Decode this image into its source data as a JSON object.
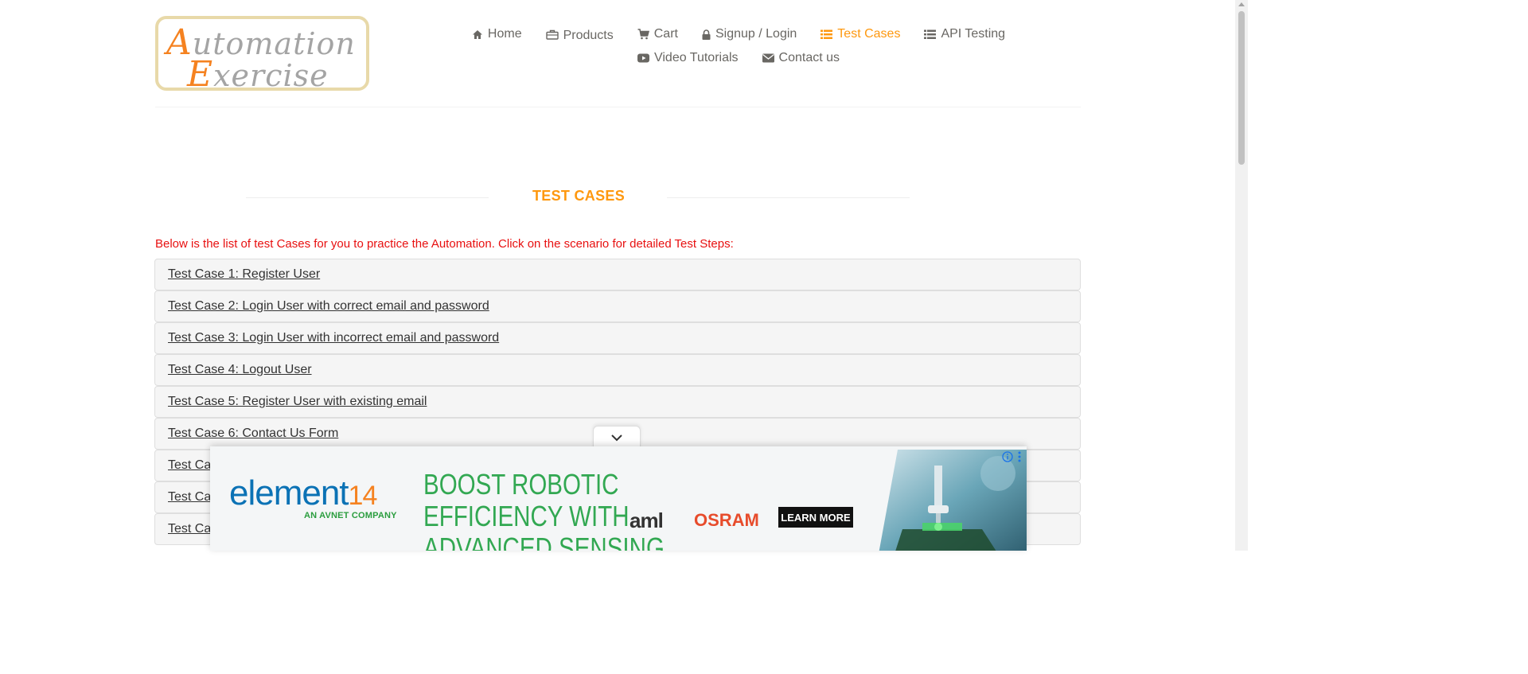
{
  "logo": {
    "line1_cap": "A",
    "line1_rest": "utomation",
    "line2_cap": "E",
    "line2_rest": "xercise"
  },
  "nav": {
    "row1": [
      {
        "label": "Home",
        "icon": "home-icon"
      },
      {
        "label": "Products",
        "icon": "briefcase-icon"
      },
      {
        "label": "Cart",
        "icon": "cart-icon"
      },
      {
        "label": "Signup / Login",
        "icon": "lock-icon"
      },
      {
        "label": "Test Cases",
        "icon": "list-icon",
        "active": true
      },
      {
        "label": "API Testing",
        "icon": "list-icon"
      }
    ],
    "row2": [
      {
        "label": "Video Tutorials",
        "icon": "youtube-icon"
      },
      {
        "label": "Contact us",
        "icon": "envelope-icon"
      }
    ],
    "active_color": "#fe980f"
  },
  "page": {
    "title": "TEST CASES",
    "intro": "Below is the list of test Cases for you to practice the Automation. Click on the scenario for detailed Test Steps:",
    "intro_color": "#e81010"
  },
  "test_cases": [
    "Test Case 1: Register User",
    "Test Case 2: Login User with correct email and password",
    "Test Case 3: Login User with incorrect email and password",
    "Test Case 4: Logout User",
    "Test Case 5: Register User with existing email",
    "Test Case 6: Contact Us Form",
    "Test Ca",
    "Test Ca",
    "Test Ca"
  ],
  "ad": {
    "brand": "element",
    "brand_num": "14",
    "brand_sub": "AN AVNET COMPANY",
    "headline": "BOOST ROBOTIC EFFICIENCY WITH ADVANCED SENSING",
    "partner1": "aml",
    "partner2": "OSRAM",
    "cta": "LEARN MORE"
  }
}
